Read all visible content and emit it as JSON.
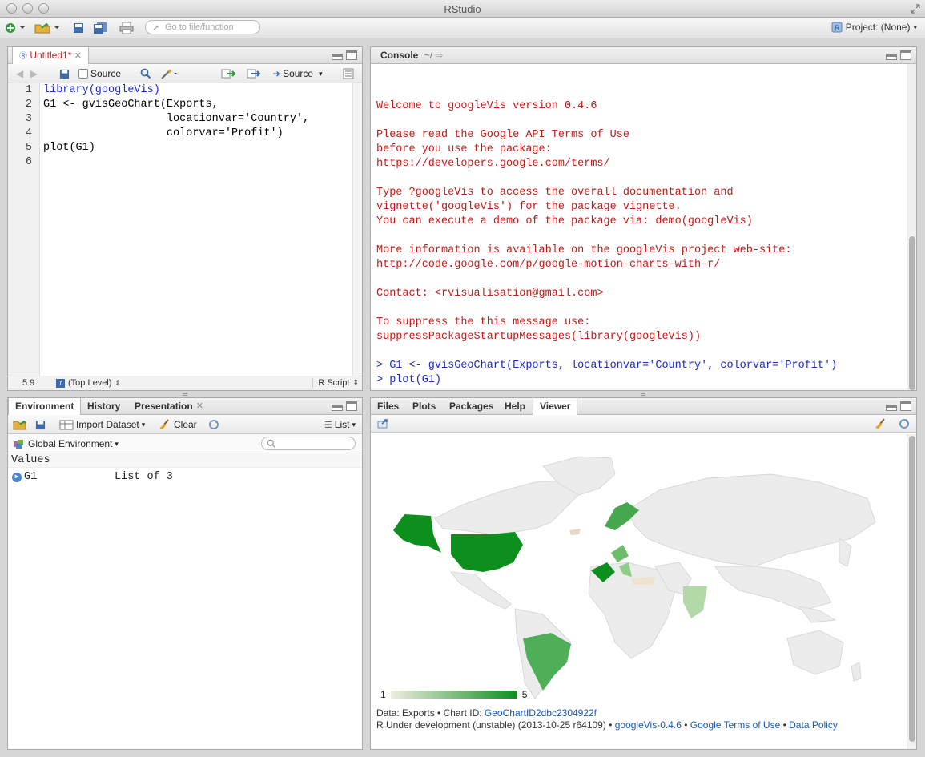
{
  "window": {
    "title": "RStudio"
  },
  "toolbar": {
    "goto_placeholder": "Go to file/function",
    "project_label": "Project: (None)"
  },
  "editor": {
    "tab_label": "Untitled1*",
    "source_on_save_label": "Source",
    "source_button_label": "Source",
    "lines": [
      {
        "n": "1",
        "text": "library(googleVis)"
      },
      {
        "n": "2",
        "text": "G1 <- gvisGeoChart(Exports,"
      },
      {
        "n": "3",
        "text": "                   locationvar='Country',"
      },
      {
        "n": "4",
        "text": "                   colorvar='Profit')"
      },
      {
        "n": "5",
        "text": "plot(G1)"
      },
      {
        "n": "6",
        "text": ""
      }
    ],
    "status_position": "5:9",
    "status_scope": "(Top Level)",
    "status_filetype": "R Script"
  },
  "console": {
    "tab_label": "Console",
    "path": "~/",
    "lines": [
      {
        "text": "Welcome to googleVis version 0.4.6",
        "color": "red"
      },
      {
        "text": "",
        "color": "red"
      },
      {
        "text": "Please read the Google API Terms of Use",
        "color": "red"
      },
      {
        "text": "before you use the package:",
        "color": "red"
      },
      {
        "text": "https://developers.google.com/terms/",
        "color": "red"
      },
      {
        "text": "",
        "color": "red"
      },
      {
        "text": "Type ?googleVis to access the overall documentation and",
        "color": "red"
      },
      {
        "text": "vignette('googleVis') for the package vignette.",
        "color": "red"
      },
      {
        "text": "You can execute a demo of the package via: demo(googleVis)",
        "color": "red"
      },
      {
        "text": "",
        "color": "red"
      },
      {
        "text": "More information is available on the googleVis project web-site:",
        "color": "red"
      },
      {
        "text": "http://code.google.com/p/google-motion-charts-with-r/",
        "color": "red"
      },
      {
        "text": "",
        "color": "red"
      },
      {
        "text": "Contact: <rvisualisation@gmail.com>",
        "color": "red"
      },
      {
        "text": "",
        "color": "red"
      },
      {
        "text": "To suppress the this message use:",
        "color": "red"
      },
      {
        "text": "suppressPackageStartupMessages(library(googleVis))",
        "color": "red"
      },
      {
        "text": "",
        "color": "red"
      },
      {
        "text": "> G1 <- gvisGeoChart(Exports, locationvar='Country', colorvar='Profit')",
        "color": "blue"
      },
      {
        "text": "> plot(G1)",
        "color": "blue"
      },
      {
        "text": "> ",
        "color": "blue"
      }
    ]
  },
  "environment": {
    "tabs": [
      "Environment",
      "History",
      "Presentation"
    ],
    "import_label": "Import Dataset",
    "clear_label": "Clear",
    "view_mode": "List",
    "scope": "Global Environment",
    "section": "Values",
    "rows": [
      {
        "name": "G1",
        "value": "List of 3"
      }
    ]
  },
  "viewer": {
    "tabs": [
      "Files",
      "Plots",
      "Packages",
      "Help",
      "Viewer"
    ],
    "legend_min": "1",
    "legend_max": "5",
    "caption_prefix": "Data: Exports • Chart ID: ",
    "chart_id": "GeoChartID2dbc2304922f",
    "r_version": "R Under development (unstable) (2013-10-25 r64109) • ",
    "link_googlevis": "googleVis-0.4.6",
    "sep": " • ",
    "link_terms": "Google Terms of Use",
    "link_policy": "Data Policy",
    "colors": {
      "high": "#0c8f1d",
      "low": "#f0ede0",
      "nodata": "#ececec"
    }
  }
}
